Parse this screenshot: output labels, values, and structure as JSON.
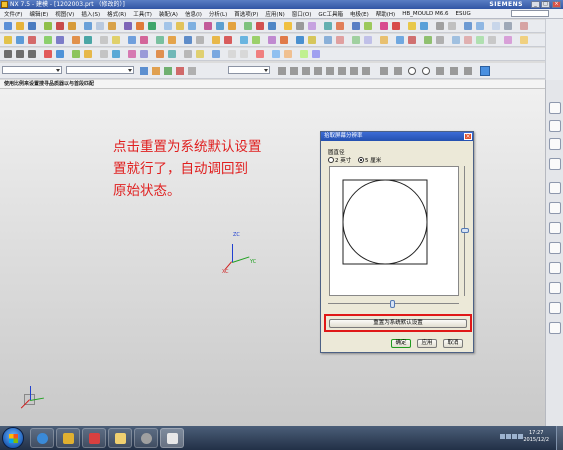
{
  "window": {
    "title": "NX 7.5 - 建模 - [1202003.prt （修改的）]",
    "brand": "SIEMENS",
    "min_label": "_",
    "max_label": "□",
    "close_label": "×"
  },
  "menu": {
    "items": [
      "文件(F)",
      "编辑(E)",
      "视图(V)",
      "插入(S)",
      "格式(R)",
      "工具(T)",
      "装配(A)",
      "信息(I)",
      "分析(L)",
      "首选项(P)",
      "应用(N)",
      "窗口(O)",
      "GC工具箱",
      "电极(E)",
      "帮助(H)",
      "HB_MOULD M6.6",
      "ESUG"
    ]
  },
  "cue_line": "使用比例来设置搜寻品质器以与首段匹配",
  "annotation": {
    "lines": [
      "点击重置为系统默认设置",
      "置就行了，自动调回到",
      "原始状态。"
    ]
  },
  "triad": {
    "x": "XC",
    "y": "YC",
    "z": "ZC"
  },
  "dialog": {
    "title": "拾取屏幕分辨率",
    "diameter_label": "圆直径",
    "options": [
      {
        "label": "2 英寸",
        "selected": false
      },
      {
        "label": "5 厘米",
        "selected": true
      }
    ],
    "reset_label": "重置为系统默认设置",
    "ok_label": "确定",
    "apply_label": "应用",
    "cancel_label": "取消"
  },
  "taskbar": {
    "time": "17:27",
    "date": "2015/12/2"
  },
  "colors": {
    "annotation": "#e02020",
    "highlight_box": "#e01818",
    "x_axis": "#d02020",
    "y_axis": "#20a020",
    "z_axis": "#2040d0"
  }
}
